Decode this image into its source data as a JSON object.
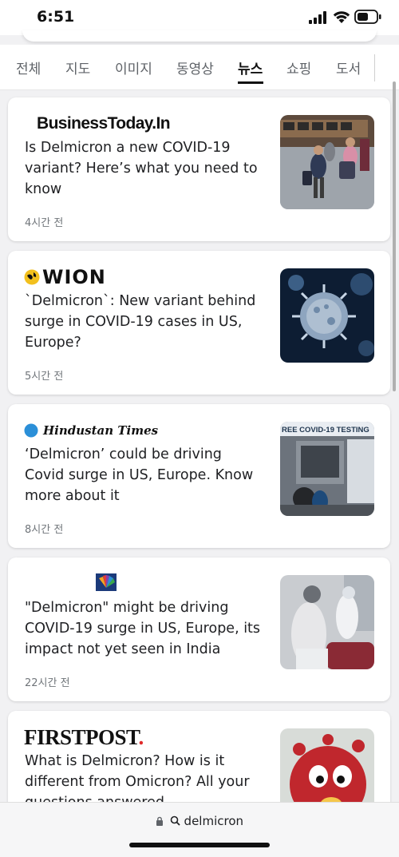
{
  "status_bar": {
    "time": "6:51"
  },
  "tabs": [
    {
      "label": "전체"
    },
    {
      "label": "지도"
    },
    {
      "label": "이미지"
    },
    {
      "label": "동영상"
    },
    {
      "label": "뉴스"
    },
    {
      "label": "쇼핑"
    },
    {
      "label": "도서"
    }
  ],
  "active_tab": "뉴스",
  "articles": [
    {
      "source": "BusinessToday.In",
      "headline": "Is Delmicron a new COVID-19 variant? Here’s what you need to know",
      "time": "4시간 전"
    },
    {
      "source": "WION",
      "headline": "`Delmicron`: New variant behind surge in COVID-19 cases in US, Europe?",
      "time": "5시간 전"
    },
    {
      "source": "Hindustan Times",
      "source_badge": "HT",
      "headline": "‘Delmicron’ could be driving Covid surge in US, Europe. Know more about it",
      "time": "8시간 전"
    },
    {
      "source": "CNBC TV18",
      "headline": "\"Delmicron\" might be driving COVID-19 surge in US, Europe, its impact not yet seen in India",
      "time": "22시간 전"
    },
    {
      "source": "FIRSTPOST",
      "headline": "What is Delmicron? How is it different from Omicron? All your questions answered",
      "time": ""
    }
  ],
  "thumbnail_texts": {
    "covid_testing_banner": "REE COVID-19 TESTING"
  },
  "address_bar": {
    "query": "delmicron"
  }
}
